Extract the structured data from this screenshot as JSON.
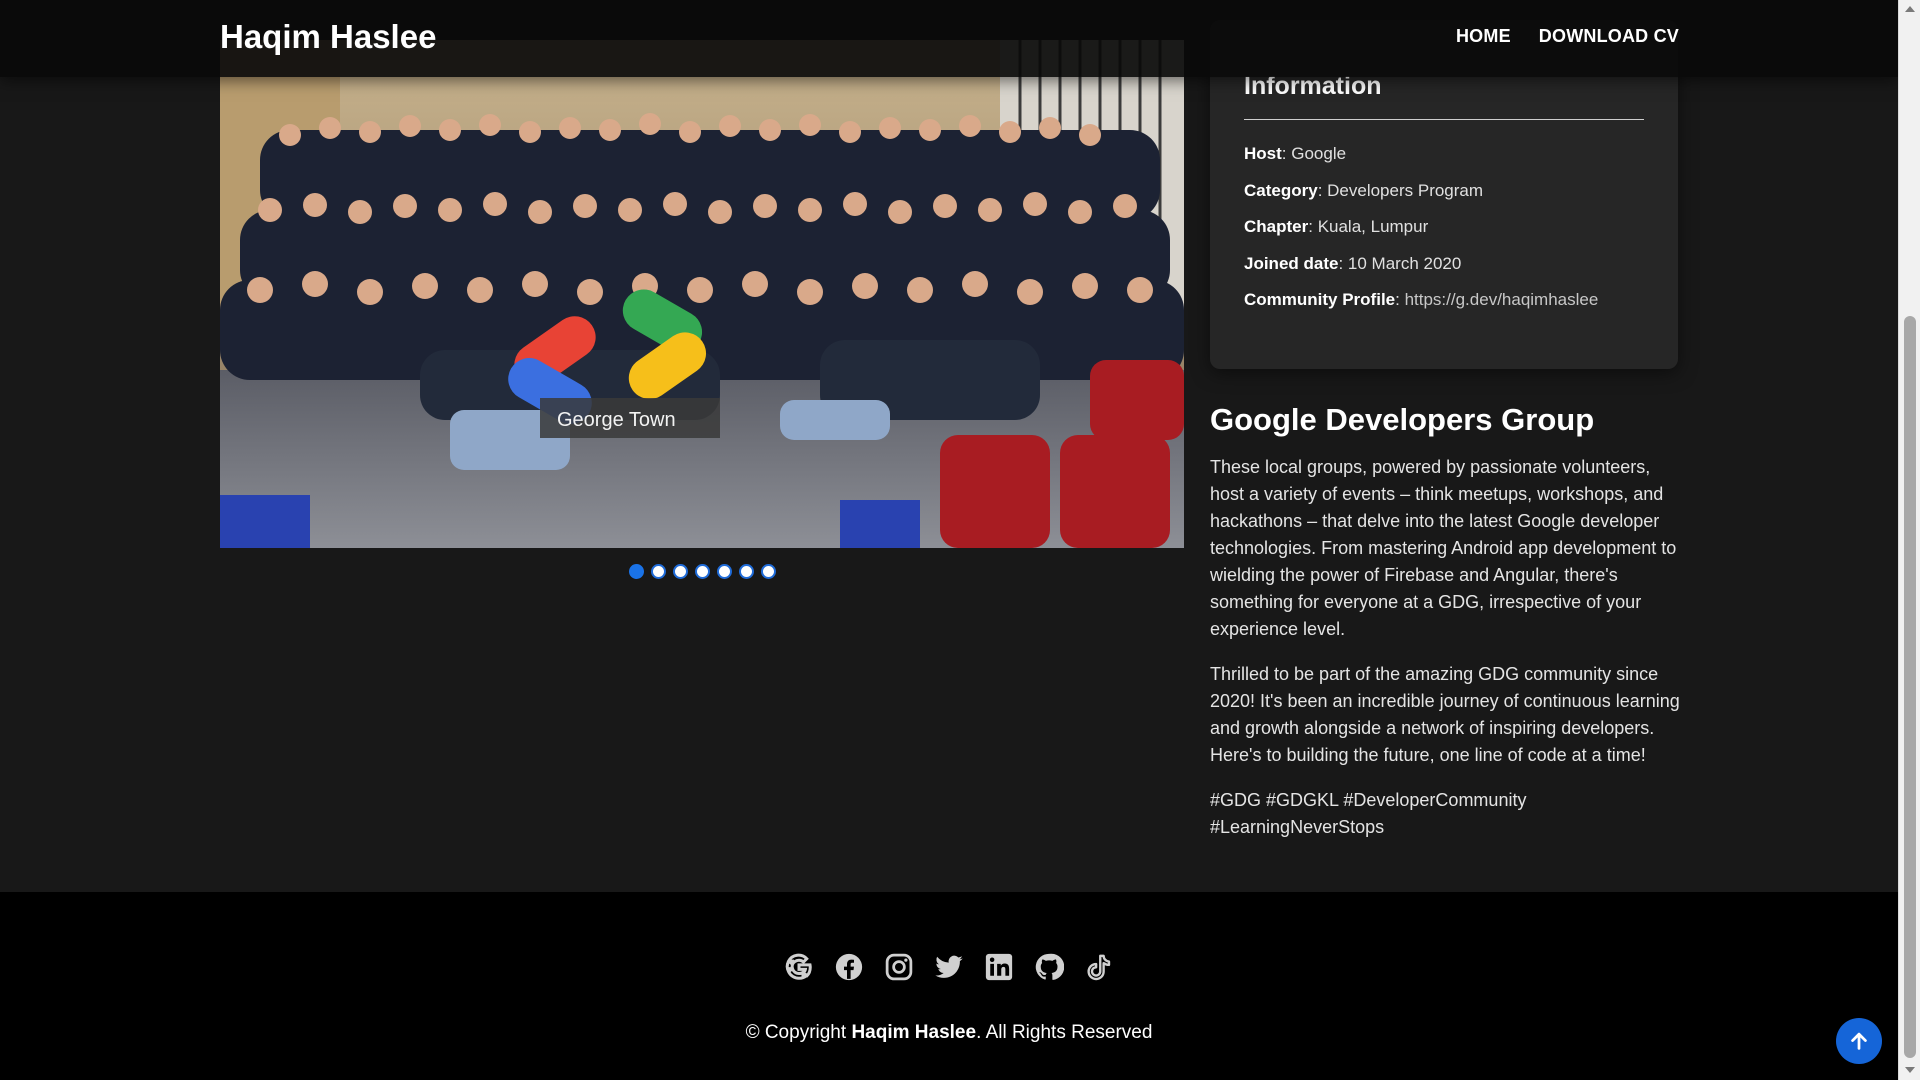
{
  "header": {
    "brand": "Haqim Haslee",
    "nav": [
      {
        "label": "HOME"
      },
      {
        "label": "DOWNLOAD CV"
      }
    ]
  },
  "carousel": {
    "photo_label": "George Town",
    "slide_count": 7,
    "active_index": 0
  },
  "info": {
    "title": "Information",
    "items": [
      {
        "key": "Host",
        "value": "Google"
      },
      {
        "key": "Category",
        "value": "Developers Program"
      },
      {
        "key": "Chapter",
        "value": "Kuala, Lumpur"
      },
      {
        "key": "Joined date",
        "value": "10 March 2020"
      },
      {
        "key": "Community Profile",
        "value": "https://g.dev/haqimhaslee"
      }
    ]
  },
  "description": {
    "heading": "Google Developers Group",
    "paragraphs": [
      "These local groups, powered by passionate volunteers, host a variety of events – think meetups, workshops, and hackathons – that delve into the latest Google developer technologies. From mastering Android app development to wielding the power of Firebase and Angular, there's something for everyone at a GDG, irrespective of your experience level.",
      "Thrilled to be part of the amazing GDG community since 2020! It's been an incredible journey of continuous learning and growth alongside a network of inspiring developers. Here's to building the future, one line of code at a time!",
      "#GDG #GDGKL #DeveloperCommunity #LearningNeverStops"
    ]
  },
  "footer": {
    "socials": [
      "google-icon",
      "facebook-icon",
      "instagram-icon",
      "twitter-icon",
      "linkedin-icon",
      "github-icon",
      "tiktok-icon"
    ],
    "copyright_prefix": "© Copyright ",
    "copyright_name": "Haqim Haslee",
    "copyright_suffix": ". All Rights Reserved"
  },
  "colors": {
    "accent": "#1a73e8",
    "background": "#181818",
    "card": "#262626",
    "footer": "#000000"
  }
}
